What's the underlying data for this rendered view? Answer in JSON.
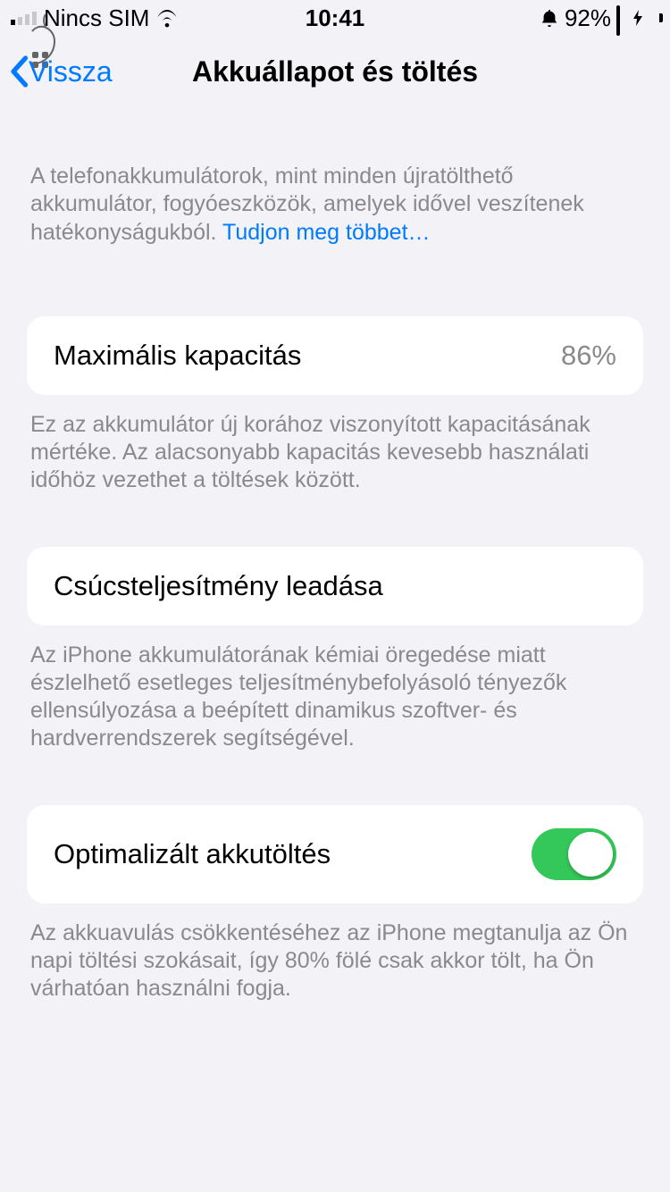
{
  "status": {
    "sim": "Nincs SIM",
    "time": "10:41",
    "battery_pct": "92%"
  },
  "nav": {
    "back_label": "Vissza",
    "title": "Akkuállapot és töltés"
  },
  "intro": {
    "text": "A telefonakkumulátorok, mint minden újratölthető akkumulátor, fogyóeszközök, amelyek idővel veszítenek hatékonyságukból. ",
    "link": "Tudjon meg többet…"
  },
  "max_capacity": {
    "label": "Maximális kapacitás",
    "value": "86%",
    "desc": "Ez az akkumulátor új korához viszonyított kapacitásának mértéke. Az alacsonyabb kapacitás kevesebb használati időhöz vezethet a töltések között."
  },
  "peak_perf": {
    "label": "Csúcsteljesítmény leadása",
    "desc": "Az iPhone akkumulátorának kémiai öregedése miatt észlelhető esetleges teljesítménybefolyásoló tényezők ellensúlyozása a beépített dinamikus szoftver- és hardverrendszerek segítségével."
  },
  "optimized": {
    "label": "Optimalizált akkutöltés",
    "toggle_on": true,
    "desc": "Az akkuavulás csökkentéséhez az iPhone megtanulja az Ön napi töltési szokásait, így 80% fölé csak akkor tölt, ha Ön várhatóan használni fogja."
  }
}
